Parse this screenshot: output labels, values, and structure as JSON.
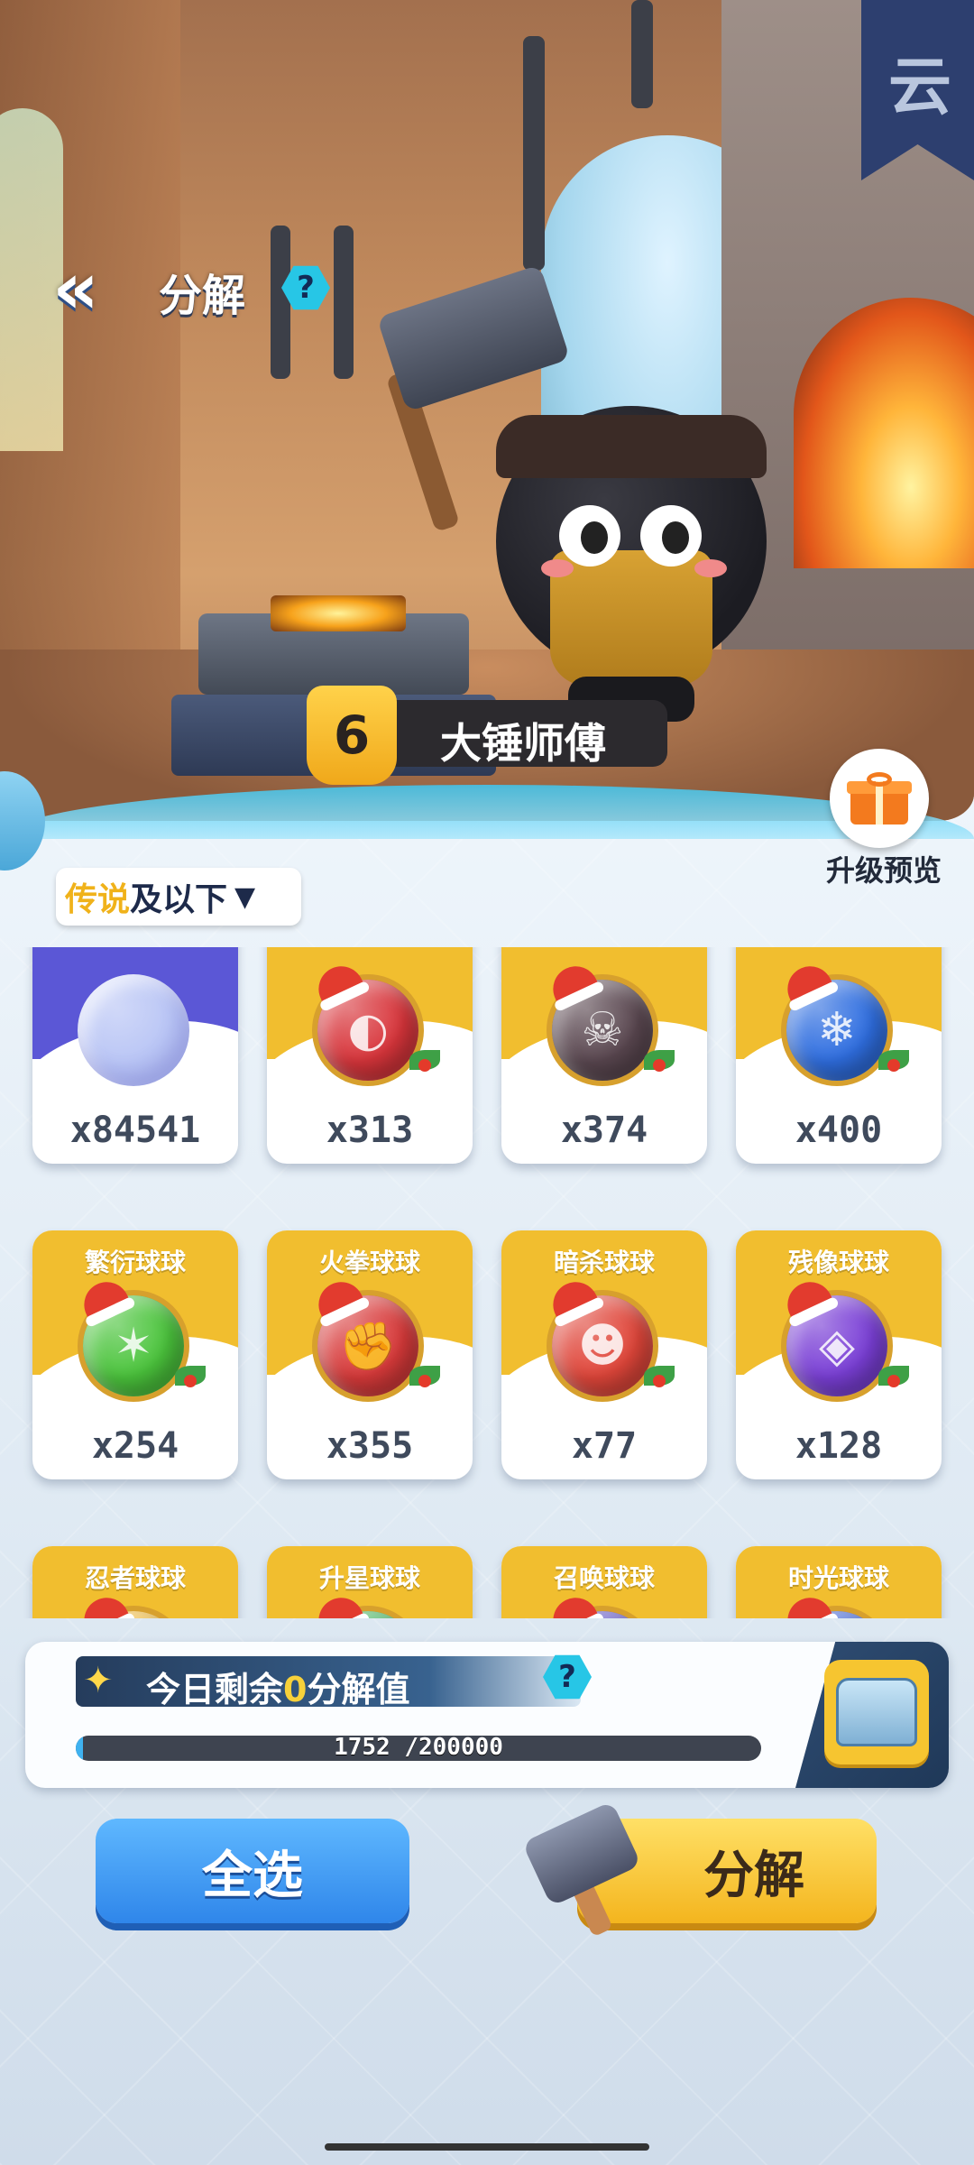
{
  "header": {
    "back_icon": "double-chevron-left-icon",
    "title": "分解",
    "help_label": "?"
  },
  "scene": {
    "banner_glyph": "云"
  },
  "npc": {
    "level": "6",
    "name": "大锤师傅"
  },
  "upgrade_preview": {
    "icon": "gift-icon",
    "label": "升级预览"
  },
  "filter": {
    "highlight": "传说",
    "rest": "及以下",
    "caret": "▼",
    "highlight_color": "#f0b21a"
  },
  "items": [
    {
      "name": "",
      "count": "x84541",
      "style": "purple",
      "ball_color": "#b9c5f5",
      "symbol": "",
      "festive": false
    },
    {
      "name": "",
      "count": "x313",
      "style": "gold",
      "ball_color": "#d8353b",
      "symbol": "◐",
      "festive": true
    },
    {
      "name": "",
      "count": "x374",
      "style": "gold",
      "ball_color": "#5a4750",
      "symbol": "☠",
      "festive": true
    },
    {
      "name": "",
      "count": "x400",
      "style": "gold",
      "ball_color": "#2f6ee0",
      "symbol": "❄",
      "festive": true
    },
    {
      "name": "繁衍球球",
      "count": "x254",
      "style": "gold",
      "ball_color": "#4bc43c",
      "symbol": "✶",
      "festive": true
    },
    {
      "name": "火拳球球",
      "count": "x355",
      "style": "gold",
      "ball_color": "#d83a3a",
      "symbol": "✊",
      "festive": true
    },
    {
      "name": "暗杀球球",
      "count": "x77",
      "style": "gold",
      "ball_color": "#e0463a",
      "symbol": "☻",
      "festive": true
    },
    {
      "name": "残像球球",
      "count": "x128",
      "style": "gold",
      "ball_color": "#7a3fd6",
      "symbol": "◈",
      "festive": true
    },
    {
      "name": "忍者球球",
      "count": "",
      "style": "gold",
      "ball_color": "#f0b836",
      "symbol": "",
      "festive": true
    },
    {
      "name": "升星球球",
      "count": "",
      "style": "gold",
      "ball_color": "#3fb35a",
      "symbol": "★",
      "festive": true
    },
    {
      "name": "召唤球球",
      "count": "",
      "style": "gold",
      "ball_color": "#5a4fc4",
      "symbol": "",
      "festive": true
    },
    {
      "name": "时光球球",
      "count": "",
      "style": "gold",
      "ball_color": "#3a5fd6",
      "symbol": "",
      "festive": true
    }
  ],
  "daily": {
    "star_icon": "star-icon",
    "prefix": "今日剩余",
    "value": "0",
    "suffix": "分解值",
    "help_label": "?",
    "progress_text": "1752 /200000",
    "progress_fraction": 0.00876,
    "chest_icon": "treasure-chest-icon"
  },
  "actions": {
    "select_all": "全选",
    "decompose": "分解"
  },
  "colors": {
    "accent_blue": "#2f86ea",
    "accent_gold": "#f4b51e",
    "help_cyan": "#27c6e6"
  }
}
